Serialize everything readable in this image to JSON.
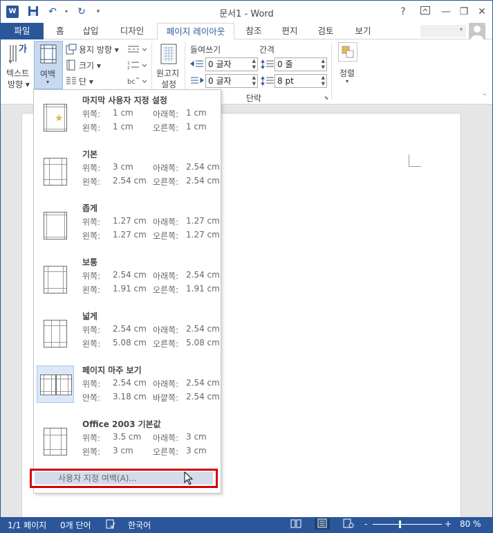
{
  "window": {
    "title": "문서1 - Word",
    "accent": "#2b579a",
    "help": "?"
  },
  "tabs": [
    {
      "label": "파일"
    },
    {
      "label": "홈"
    },
    {
      "label": "삽입"
    },
    {
      "label": "디자인"
    },
    {
      "label": "페이지 레이아웃"
    },
    {
      "label": "참조"
    },
    {
      "label": "편지"
    },
    {
      "label": "검토"
    },
    {
      "label": "보기"
    }
  ],
  "ribbon": {
    "text_direction": {
      "line1": "텍스트",
      "line2": "방향 ▾"
    },
    "margins": {
      "line1": "여백",
      "line2": "▾"
    },
    "orientation": "용지 방향 ▾",
    "size": "크기 ▾",
    "columns": "단 ▾",
    "manuscript": {
      "line1": "원고지",
      "line2": "설정"
    },
    "indent_title": "들여쓰기",
    "spacing_title": "간격",
    "indent_left": "0 글자",
    "indent_right": "0 글자",
    "spacing_before": "0 줄",
    "spacing_after": "8 pt",
    "paragraph_group": "단락",
    "arrange": {
      "line1": "정렬",
      "line2": "▾"
    }
  },
  "margins_menu": {
    "items": [
      {
        "title": "마지막 사용자 지정 설정",
        "k1": "위쪽:",
        "v1": "1 cm",
        "k2": "아래쪽:",
        "v2": "1 cm",
        "k3": "왼쪽:",
        "v3": "1 cm",
        "k4": "오른쪽:",
        "v4": "1 cm"
      },
      {
        "title": "기본",
        "k1": "위쪽:",
        "v1": "3 cm",
        "k2": "아래쪽:",
        "v2": "2.54 cm",
        "k3": "왼쪽:",
        "v3": "2.54 cm",
        "k4": "오른쪽:",
        "v4": "2.54 cm"
      },
      {
        "title": "좁게",
        "k1": "위쪽:",
        "v1": "1.27 cm",
        "k2": "아래쪽:",
        "v2": "1.27 cm",
        "k3": "왼쪽:",
        "v3": "1.27 cm",
        "k4": "오른쪽:",
        "v4": "1.27 cm"
      },
      {
        "title": "보통",
        "k1": "위쪽:",
        "v1": "2.54 cm",
        "k2": "아래쪽:",
        "v2": "2.54 cm",
        "k3": "왼쪽:",
        "v3": "1.91 cm",
        "k4": "오른쪽:",
        "v4": "1.91 cm"
      },
      {
        "title": "넓게",
        "k1": "위쪽:",
        "v1": "2.54 cm",
        "k2": "아래쪽:",
        "v2": "2.54 cm",
        "k3": "왼쪽:",
        "v3": "5.08 cm",
        "k4": "오른쪽:",
        "v4": "5.08 cm"
      },
      {
        "title": "페이지 마주 보기",
        "k1": "위쪽:",
        "v1": "2.54 cm",
        "k2": "아래쪽:",
        "v2": "2.54 cm",
        "k3": "안쪽:",
        "v3": "3.18 cm",
        "k4": "바깥쪽:",
        "v4": "2.54 cm"
      },
      {
        "title": "Office 2003 기본값",
        "k1": "위쪽:",
        "v1": "3.5 cm",
        "k2": "아래쪽:",
        "v2": "3 cm",
        "k3": "왼쪽:",
        "v3": "3 cm",
        "k4": "오른쪽:",
        "v4": "3 cm"
      }
    ],
    "custom": "사용자 지정 여백(A)..."
  },
  "status": {
    "page": "1/1 페이지",
    "words": "0개 단어",
    "language": "한국어",
    "zoom": "80 %",
    "zoom_minus": "-",
    "zoom_plus": "+"
  }
}
